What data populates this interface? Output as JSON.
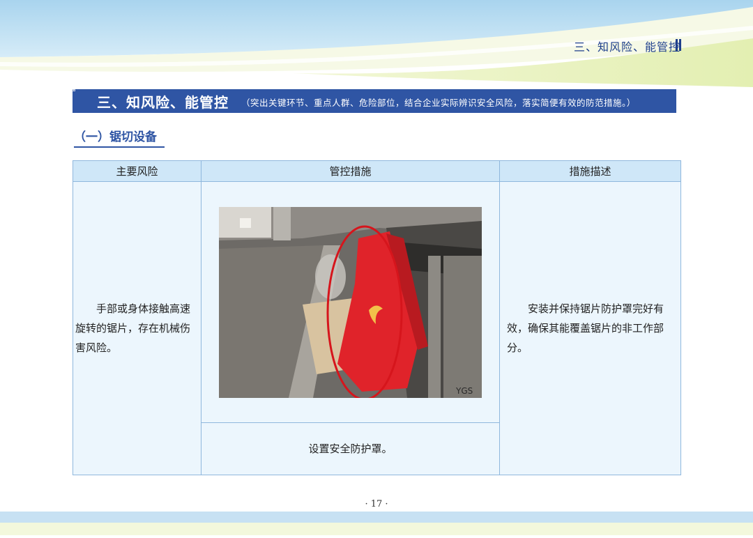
{
  "header": {
    "running_title": "三、知风险、能管控"
  },
  "section": {
    "title": "三、知风险、能管控",
    "note": "（突出关键环节、重点人群、危险部位，结合企业实际辨识安全风险，落实简便有效的防范措施。）"
  },
  "subsection": {
    "title": "（一）锯切设备"
  },
  "table": {
    "headers": [
      "主要风险",
      "管控措施",
      "措施描述"
    ],
    "risk": "手部或身体接触高速旋转的锯片，存在机械伤害风险。",
    "caption": "设置安全防护罩。",
    "description": "安装并保持锯片防护罩完好有效，确保其能覆盖锯片的非工作部分。"
  },
  "photo": {
    "marking": "YGS"
  },
  "footer": {
    "page_number": "· 17 ·"
  },
  "colors": {
    "accent": "#2f55a4",
    "table_header": "#cfe7f8",
    "table_body": "#ecf6fd",
    "guard_red": "#e0232a"
  }
}
